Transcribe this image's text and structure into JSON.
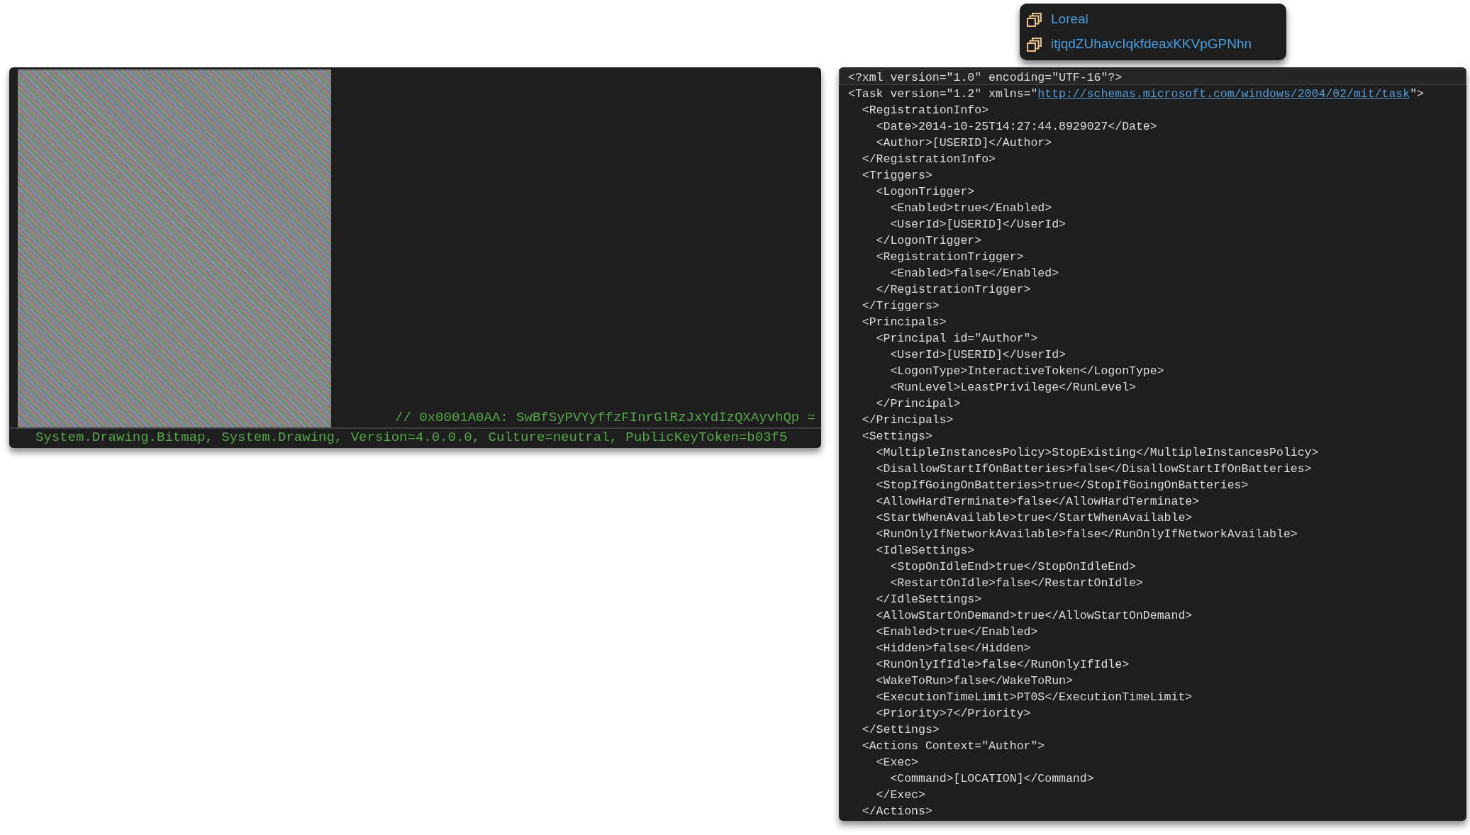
{
  "popup_menu": {
    "items": [
      {
        "label": "Loreal"
      },
      {
        "label": "itjqdZUhavcIqkfdeaxKKVpGPNhn"
      }
    ]
  },
  "bitmap_panel": {
    "comment": "// 0x0001A0AA: SwBfSyPVYyffzFInrGlRzJxYdIzQXAyvhQp =",
    "type_line": "System.Drawing.Bitmap, System.Drawing, Version=4.0.0.0, Culture=neutral, PublicKeyToken=b03f5"
  },
  "xml_panel": {
    "lines": [
      {
        "kind": "plain",
        "text": "<?xml version=\"1.0\" encoding=\"UTF-16\"?>",
        "selected": true
      },
      {
        "kind": "link",
        "before": "<Task version=\"1.2\" xmlns=\"",
        "link": "http://schemas.microsoft.com/windows/2004/02/mit/task",
        "after": "\">",
        "selected": false
      },
      {
        "kind": "plain",
        "text": "  <RegistrationInfo>",
        "selected": false
      },
      {
        "kind": "plain",
        "text": "    <Date>2014-10-25T14:27:44.8929027</Date>",
        "selected": false
      },
      {
        "kind": "plain",
        "text": "    <Author>[USERID]</Author>",
        "selected": false
      },
      {
        "kind": "plain",
        "text": "  </RegistrationInfo>",
        "selected": false
      },
      {
        "kind": "plain",
        "text": "  <Triggers>",
        "selected": false
      },
      {
        "kind": "plain",
        "text": "    <LogonTrigger>",
        "selected": false
      },
      {
        "kind": "plain",
        "text": "      <Enabled>true</Enabled>",
        "selected": false
      },
      {
        "kind": "plain",
        "text": "      <UserId>[USERID]</UserId>",
        "selected": false
      },
      {
        "kind": "plain",
        "text": "    </LogonTrigger>",
        "selected": false
      },
      {
        "kind": "plain",
        "text": "    <RegistrationTrigger>",
        "selected": false
      },
      {
        "kind": "plain",
        "text": "      <Enabled>false</Enabled>",
        "selected": false
      },
      {
        "kind": "plain",
        "text": "    </RegistrationTrigger>",
        "selected": false
      },
      {
        "kind": "plain",
        "text": "  </Triggers>",
        "selected": false
      },
      {
        "kind": "plain",
        "text": "  <Principals>",
        "selected": false
      },
      {
        "kind": "plain",
        "text": "    <Principal id=\"Author\">",
        "selected": false
      },
      {
        "kind": "plain",
        "text": "      <UserId>[USERID]</UserId>",
        "selected": false
      },
      {
        "kind": "plain",
        "text": "      <LogonType>InteractiveToken</LogonType>",
        "selected": false
      },
      {
        "kind": "plain",
        "text": "      <RunLevel>LeastPrivilege</RunLevel>",
        "selected": false
      },
      {
        "kind": "plain",
        "text": "    </Principal>",
        "selected": false
      },
      {
        "kind": "plain",
        "text": "  </Principals>",
        "selected": false
      },
      {
        "kind": "plain",
        "text": "  <Settings>",
        "selected": false
      },
      {
        "kind": "plain",
        "text": "    <MultipleInstancesPolicy>StopExisting</MultipleInstancesPolicy>",
        "selected": false
      },
      {
        "kind": "plain",
        "text": "    <DisallowStartIfOnBatteries>false</DisallowStartIfOnBatteries>",
        "selected": false
      },
      {
        "kind": "plain",
        "text": "    <StopIfGoingOnBatteries>true</StopIfGoingOnBatteries>",
        "selected": false
      },
      {
        "kind": "plain",
        "text": "    <AllowHardTerminate>false</AllowHardTerminate>",
        "selected": false
      },
      {
        "kind": "plain",
        "text": "    <StartWhenAvailable>true</StartWhenAvailable>",
        "selected": false
      },
      {
        "kind": "plain",
        "text": "    <RunOnlyIfNetworkAvailable>false</RunOnlyIfNetworkAvailable>",
        "selected": false
      },
      {
        "kind": "plain",
        "text": "    <IdleSettings>",
        "selected": false
      },
      {
        "kind": "plain",
        "text": "      <StopOnIdleEnd>true</StopOnIdleEnd>",
        "selected": false
      },
      {
        "kind": "plain",
        "text": "      <RestartOnIdle>false</RestartOnIdle>",
        "selected": false
      },
      {
        "kind": "plain",
        "text": "    </IdleSettings>",
        "selected": false
      },
      {
        "kind": "plain",
        "text": "    <AllowStartOnDemand>true</AllowStartOnDemand>",
        "selected": false
      },
      {
        "kind": "plain",
        "text": "    <Enabled>true</Enabled>",
        "selected": false
      },
      {
        "kind": "plain",
        "text": "    <Hidden>false</Hidden>",
        "selected": false
      },
      {
        "kind": "plain",
        "text": "    <RunOnlyIfIdle>false</RunOnlyIfIdle>",
        "selected": false
      },
      {
        "kind": "plain",
        "text": "    <WakeToRun>false</WakeToRun>",
        "selected": false
      },
      {
        "kind": "plain",
        "text": "    <ExecutionTimeLimit>PT0S</ExecutionTimeLimit>",
        "selected": false
      },
      {
        "kind": "plain",
        "text": "    <Priority>7</Priority>",
        "selected": false
      },
      {
        "kind": "plain",
        "text": "  </Settings>",
        "selected": false
      },
      {
        "kind": "plain",
        "text": "  <Actions Context=\"Author\">",
        "selected": false
      },
      {
        "kind": "plain",
        "text": "    <Exec>",
        "selected": false
      },
      {
        "kind": "plain",
        "text": "      <Command>[LOCATION]</Command>",
        "selected": false
      },
      {
        "kind": "plain",
        "text": "    </Exec>",
        "selected": false
      },
      {
        "kind": "plain",
        "text": "  </Actions>",
        "selected": false
      }
    ]
  }
}
